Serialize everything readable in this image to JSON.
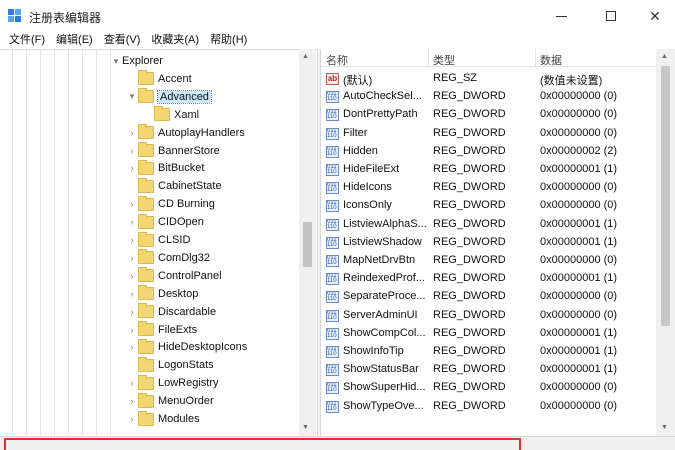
{
  "window": {
    "title": "注册表编辑器"
  },
  "menu": [
    "文件(F)",
    "编辑(E)",
    "查看(V)",
    "收藏夹(A)",
    "帮助(H)"
  ],
  "tree": [
    {
      "label": "Explorer",
      "arrow": "▾",
      "depth": 0
    },
    {
      "label": "Accent",
      "arrow": "",
      "depth": 1
    },
    {
      "label": "Advanced",
      "arrow": "▾",
      "depth": 1,
      "selected": true
    },
    {
      "label": "Xaml",
      "arrow": "",
      "depth": 2
    },
    {
      "label": "AutoplayHandlers",
      "arrow": "›",
      "depth": 1
    },
    {
      "label": "BannerStore",
      "arrow": "›",
      "depth": 1
    },
    {
      "label": "BitBucket",
      "arrow": "›",
      "depth": 1
    },
    {
      "label": "CabinetState",
      "arrow": "",
      "depth": 1
    },
    {
      "label": "CD Burning",
      "arrow": "›",
      "depth": 1
    },
    {
      "label": "CIDOpen",
      "arrow": "›",
      "depth": 1
    },
    {
      "label": "CLSID",
      "arrow": "›",
      "depth": 1
    },
    {
      "label": "ComDlg32",
      "arrow": "›",
      "depth": 1
    },
    {
      "label": "ControlPanel",
      "arrow": "›",
      "depth": 1
    },
    {
      "label": "Desktop",
      "arrow": "›",
      "depth": 1
    },
    {
      "label": "Discardable",
      "arrow": "›",
      "depth": 1
    },
    {
      "label": "FileExts",
      "arrow": "›",
      "depth": 1
    },
    {
      "label": "HideDesktopIcons",
      "arrow": "›",
      "depth": 1
    },
    {
      "label": "LogonStats",
      "arrow": "",
      "depth": 1
    },
    {
      "label": "LowRegistry",
      "arrow": "›",
      "depth": 1
    },
    {
      "label": "MenuOrder",
      "arrow": "›",
      "depth": 1
    },
    {
      "label": "Modules",
      "arrow": "›",
      "depth": 1
    }
  ],
  "list": {
    "headers": {
      "name": "名称",
      "type": "类型",
      "data": "数据"
    },
    "rows": [
      {
        "name": "(默认)",
        "type": "REG_SZ",
        "data": "(数值未设置)",
        "icon": "string-value-icon"
      },
      {
        "name": "AutoCheckSel...",
        "type": "REG_DWORD",
        "data": "0x00000000 (0)",
        "icon": "dword-value-icon"
      },
      {
        "name": "DontPrettyPath",
        "type": "REG_DWORD",
        "data": "0x00000000 (0)",
        "icon": "dword-value-icon"
      },
      {
        "name": "Filter",
        "type": "REG_DWORD",
        "data": "0x00000000 (0)",
        "icon": "dword-value-icon"
      },
      {
        "name": "Hidden",
        "type": "REG_DWORD",
        "data": "0x00000002 (2)",
        "icon": "dword-value-icon"
      },
      {
        "name": "HideFileExt",
        "type": "REG_DWORD",
        "data": "0x00000001 (1)",
        "icon": "dword-value-icon"
      },
      {
        "name": "HideIcons",
        "type": "REG_DWORD",
        "data": "0x00000000 (0)",
        "icon": "dword-value-icon"
      },
      {
        "name": "IconsOnly",
        "type": "REG_DWORD",
        "data": "0x00000000 (0)",
        "icon": "dword-value-icon"
      },
      {
        "name": "ListviewAlphaS...",
        "type": "REG_DWORD",
        "data": "0x00000001 (1)",
        "icon": "dword-value-icon"
      },
      {
        "name": "ListviewShadow",
        "type": "REG_DWORD",
        "data": "0x00000001 (1)",
        "icon": "dword-value-icon"
      },
      {
        "name": "MapNetDrvBtn",
        "type": "REG_DWORD",
        "data": "0x00000000 (0)",
        "icon": "dword-value-icon"
      },
      {
        "name": "ReindexedProf...",
        "type": "REG_DWORD",
        "data": "0x00000001 (1)",
        "icon": "dword-value-icon"
      },
      {
        "name": "SeparateProce...",
        "type": "REG_DWORD",
        "data": "0x00000000 (0)",
        "icon": "dword-value-icon"
      },
      {
        "name": "ServerAdminUI",
        "type": "REG_DWORD",
        "data": "0x00000000 (0)",
        "icon": "dword-value-icon"
      },
      {
        "name": "ShowCompCol...",
        "type": "REG_DWORD",
        "data": "0x00000001 (1)",
        "icon": "dword-value-icon"
      },
      {
        "name": "ShowInfoTip",
        "type": "REG_DWORD",
        "data": "0x00000001 (1)",
        "icon": "dword-value-icon"
      },
      {
        "name": "ShowStatusBar",
        "type": "REG_DWORD",
        "data": "0x00000001 (1)",
        "icon": "dword-value-icon"
      },
      {
        "name": "ShowSuperHid...",
        "type": "REG_DWORD",
        "data": "0x00000000 (0)",
        "icon": "dword-value-icon"
      },
      {
        "name": "ShowTypeOve...",
        "type": "REG_DWORD",
        "data": "0x00000000 (0)",
        "icon": "dword-value-icon"
      }
    ]
  },
  "colors": {
    "selection": "#cce8ff",
    "folder": "#f3d572",
    "highlight_box": "#e0312f"
  }
}
